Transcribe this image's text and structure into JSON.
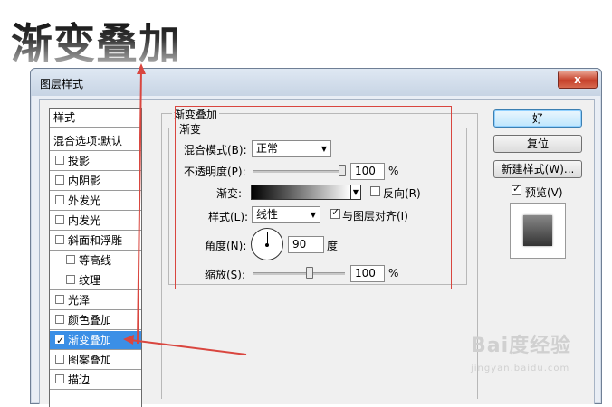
{
  "headline": "渐变叠加",
  "window": {
    "title": "图层样式",
    "close_label": "x"
  },
  "left_panel": {
    "header": "样式",
    "blend_options": "混合选项:默认",
    "items": [
      {
        "label": "投影",
        "checked": false
      },
      {
        "label": "内阴影",
        "checked": false
      },
      {
        "label": "外发光",
        "checked": false
      },
      {
        "label": "内发光",
        "checked": false
      },
      {
        "label": "斜面和浮雕",
        "checked": false
      },
      {
        "label": "等高线",
        "checked": false
      },
      {
        "label": "纹理",
        "checked": false
      },
      {
        "label": "光泽",
        "checked": false
      },
      {
        "label": "颜色叠加",
        "checked": false
      },
      {
        "label": "渐变叠加",
        "checked": true,
        "selected": true
      },
      {
        "label": "图案叠加",
        "checked": false
      },
      {
        "label": "描边",
        "checked": false
      }
    ]
  },
  "panel": {
    "group_title": "渐变叠加",
    "sub_title": "渐变",
    "blend_mode_label": "混合模式(B):",
    "blend_mode_value": "正常",
    "opacity_label": "不透明度(P):",
    "opacity_value": "100",
    "opacity_unit": "%",
    "gradient_label": "渐变:",
    "reverse_label": "反向(R)",
    "style_label": "样式(L):",
    "style_value": "线性",
    "align_label": "与图层对齐(I)",
    "align_checked": true,
    "angle_label": "角度(N):",
    "angle_value": "90",
    "angle_unit": "度",
    "scale_label": "缩放(S):",
    "scale_value": "100",
    "scale_unit": "%"
  },
  "buttons": {
    "ok": "好",
    "reset": "复位",
    "new_style": "新建样式(W)...",
    "preview_label": "预览(V)",
    "preview_checked": true
  },
  "watermark": {
    "brand": "Bai度经验",
    "url": "jingyan.baidu.com"
  },
  "colors": {
    "annotation_red": "#d9463f",
    "selection_blue": "#3b8fe6"
  }
}
